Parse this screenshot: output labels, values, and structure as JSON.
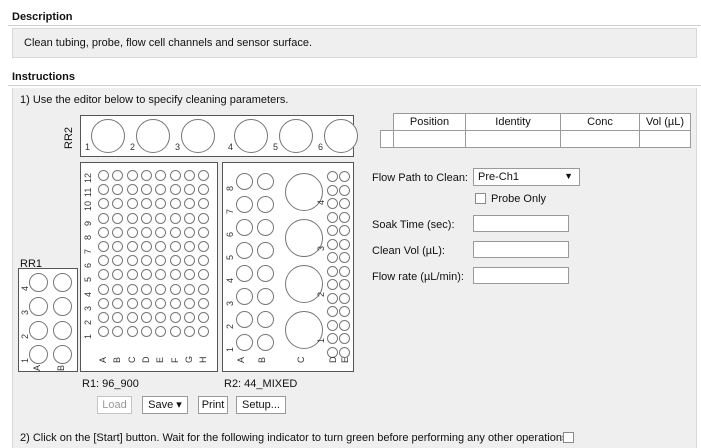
{
  "description": {
    "heading": "Description",
    "text": "Clean tubing, probe, flow cell channels and sensor surface."
  },
  "instructions": {
    "heading": "Instructions",
    "step1": "1) Use the editor below to specify cleaning parameters.",
    "step2": "2) Click on the [Start] button.  Wait for the following indicator to turn green before performing any other operations."
  },
  "racks": {
    "rr2": {
      "label": "RR2",
      "positions": [
        "1",
        "2",
        "3",
        "4",
        "5",
        "6"
      ]
    },
    "rr1": {
      "label": "RR1",
      "rows": [
        "4",
        "3",
        "2",
        "1"
      ],
      "cols": [
        "A",
        "B"
      ]
    },
    "r1": {
      "label": "R1:  96_900",
      "rows": [
        "12",
        "11",
        "10",
        "9",
        "8",
        "7",
        "6",
        "5",
        "4",
        "3",
        "2",
        "1"
      ],
      "cols": [
        "A",
        "B",
        "C",
        "D",
        "E",
        "F",
        "G",
        "H"
      ]
    },
    "r2": {
      "label": "R2:  44_MIXED",
      "left_rows": [
        "8",
        "7",
        "6",
        "5",
        "4",
        "3",
        "2",
        "1"
      ],
      "cols": [
        "A",
        "B",
        "C",
        "D",
        "E"
      ]
    }
  },
  "rack_buttons": {
    "load": "Load",
    "save": "Save",
    "print": "Print",
    "setup": "Setup...",
    "save_arrow": "▾"
  },
  "table": {
    "headers": [
      "Position",
      "Identity",
      "Conc",
      "Vol (µL)"
    ],
    "rows": [
      [
        "",
        "",
        "",
        ""
      ]
    ]
  },
  "form": {
    "flow_path_label": "Flow Path to Clean:",
    "flow_path_value": "Pre-Ch1",
    "probe_only_label": "Probe Only",
    "probe_only_checked": false,
    "soak_time_label": "Soak Time (sec):",
    "soak_time_value": "",
    "clean_vol_label": "Clean Vol (µL):",
    "clean_vol_value": "",
    "flow_rate_label": "Flow rate (µL/min):",
    "flow_rate_value": ""
  },
  "indicator_checked": false
}
